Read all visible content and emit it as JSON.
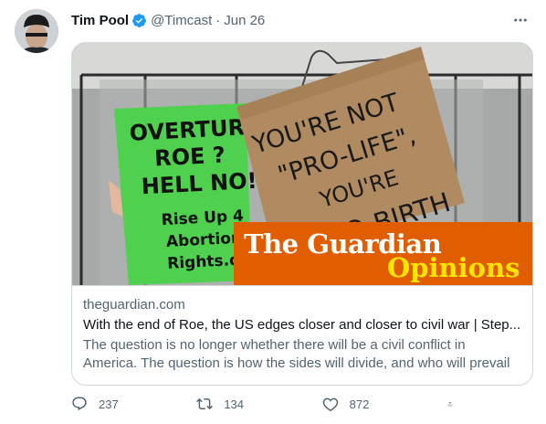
{
  "tweet": {
    "author_name": "Tim Pool",
    "handle": "@Timcast",
    "separator": "·",
    "date": "Jun 26"
  },
  "card": {
    "image": {
      "sign_left_lines": [
        "OVERTURN",
        "ROE ?",
        "HELL NO!",
        "Rise Up 4",
        "Abortion",
        "Rights.o"
      ],
      "sign_right_lines": [
        "YOU'RE NOT",
        "\"PRO-LIFE\",",
        "YOU'RE",
        "PRO-BIRTH"
      ],
      "banner_logo": "The Guardian",
      "banner_section": "Opinions",
      "colors": {
        "banner": "#e05e00",
        "sign_green": "#4fd14f",
        "cardboard": "#b08a60"
      }
    },
    "domain": "theguardian.com",
    "title": "With the end of Roe, the US edges closer and closer to civil war | Step...",
    "description": "The question is no longer whether there will be a civil conflict in America. The question is how the sides will divide, and who will prevail"
  },
  "actions": {
    "replies": "237",
    "retweets": "134",
    "likes": "872"
  },
  "colors": {
    "verified": "#1d9bf0",
    "muted": "#536471"
  }
}
